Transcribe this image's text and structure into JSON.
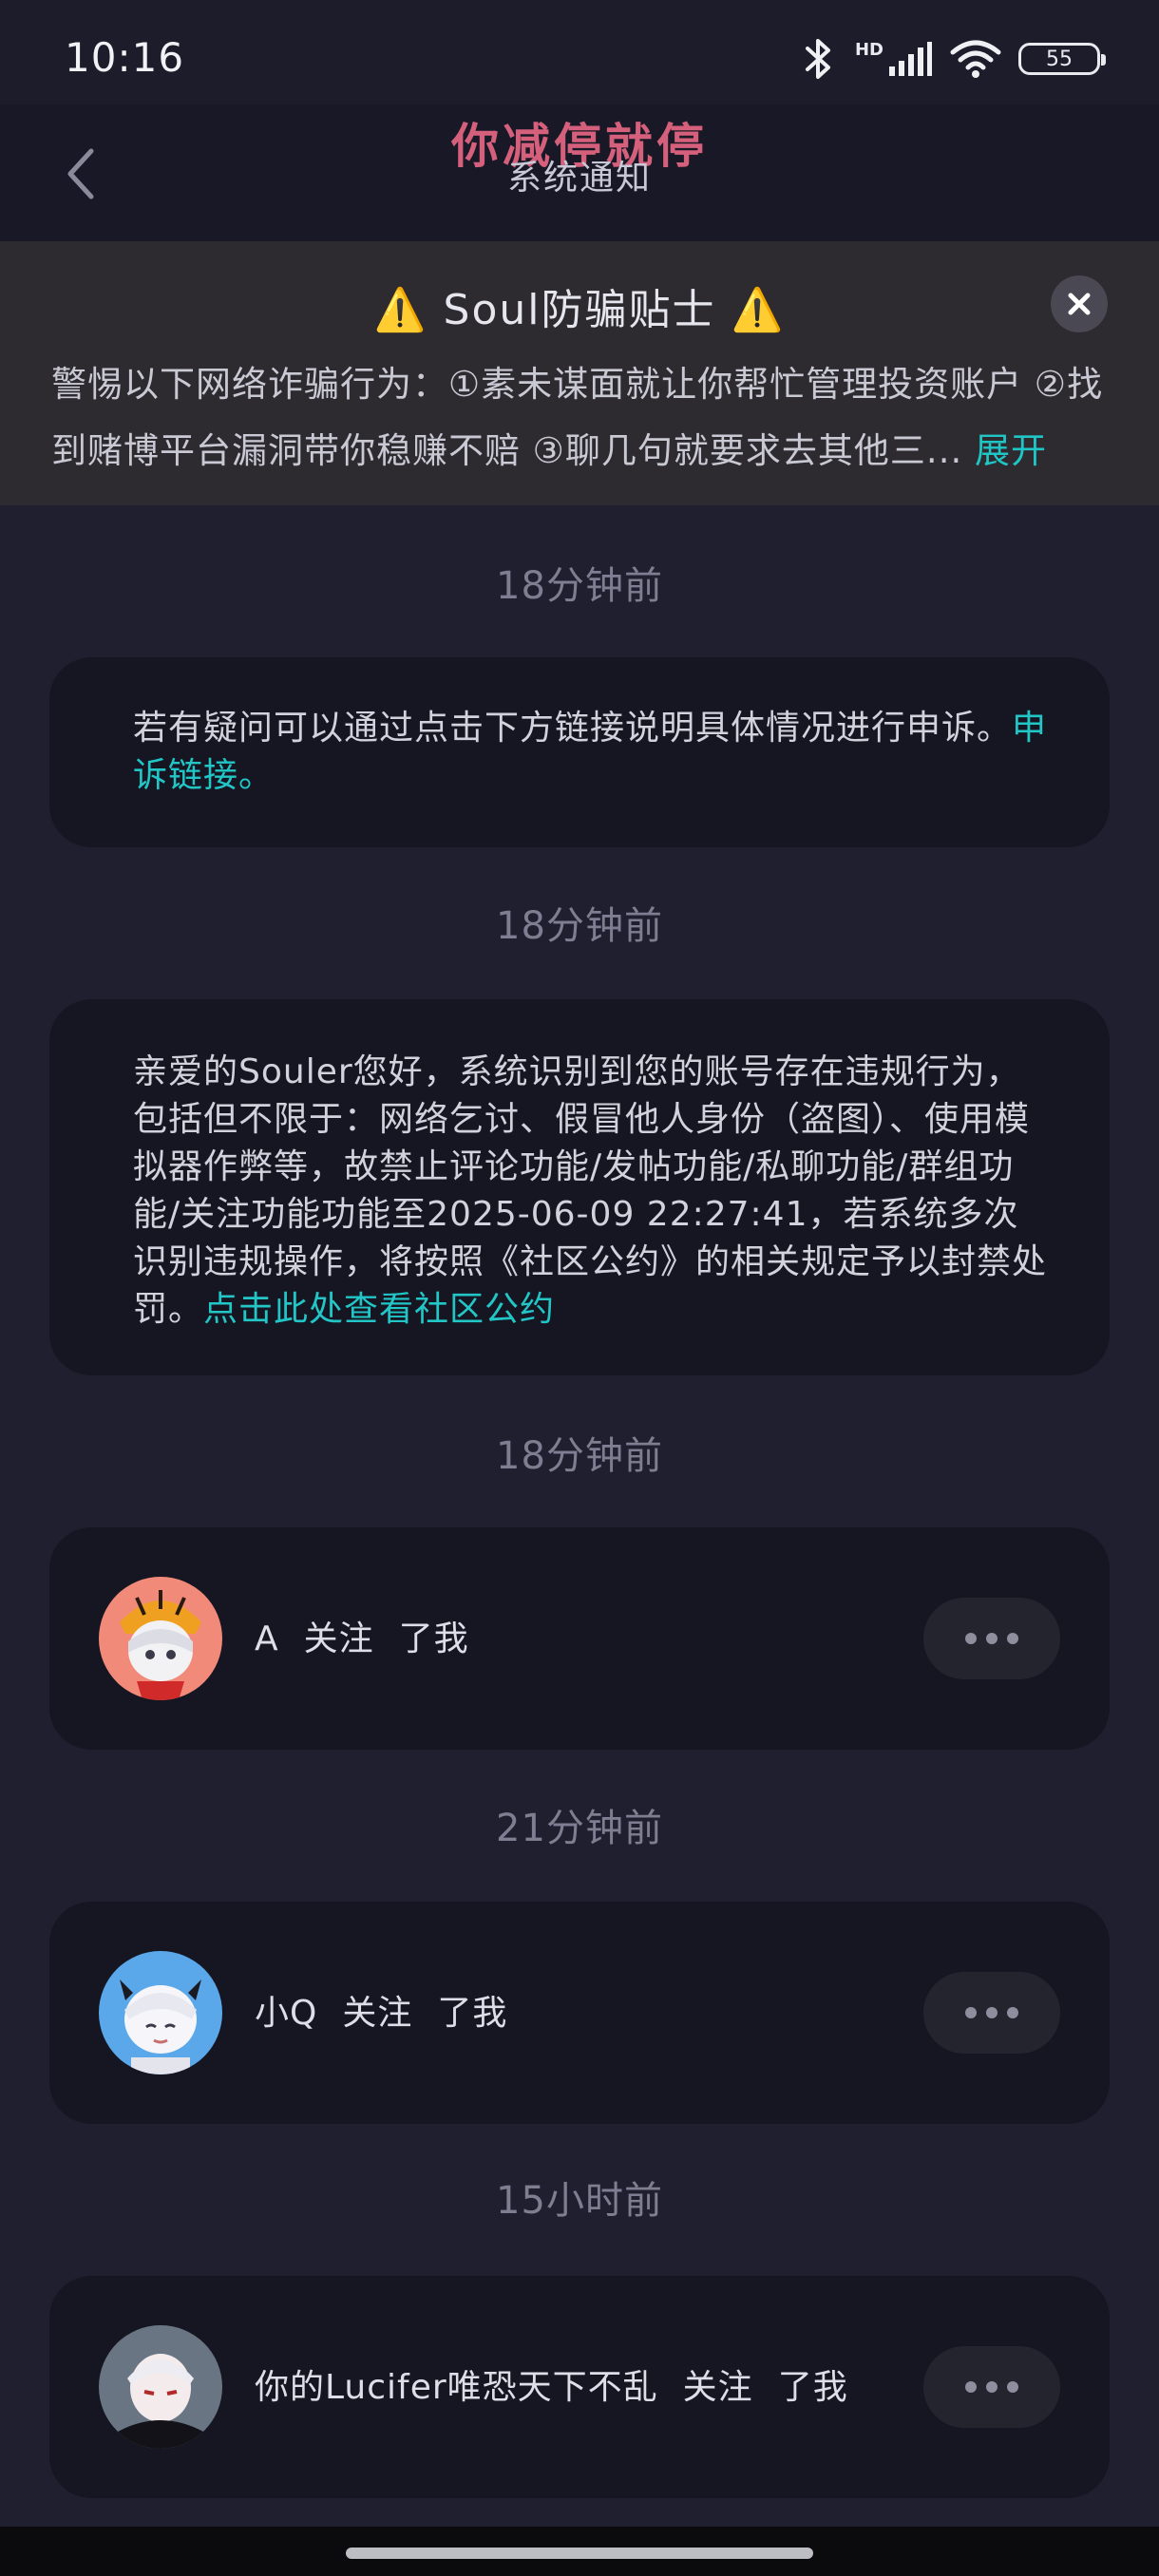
{
  "status_bar": {
    "time": "10:16",
    "hd": "HD",
    "battery": "55"
  },
  "header": {
    "brand": "你减停就停",
    "title": "系统通知"
  },
  "notice": {
    "title": "Soul防骗贴士",
    "warning_icon": "⚠️",
    "body": "警惕以下网络诈骗行为：①素未谋面就让你帮忙管理投资账户 ②找到赌博平台漏洞带你稳赚不赔 ③聊几句就要求去其他三...",
    "expand_label": "展开"
  },
  "messages": [
    {
      "time": "18分钟前",
      "type": "text",
      "text": "若有疑问可以通过点击下方链接说明具体情况进行申诉。",
      "link_label": "申诉链接。"
    },
    {
      "time": "18分钟前",
      "type": "text",
      "text": "亲爱的Souler您好，系统识别到您的账号存在违规行为，包括但不限于：网络乞讨、假冒他人身份（盗图）、使用模拟器作弊等，故禁止评论功能/发帖功能/私聊功能/群组功能/关注功能功能至2025-06-09 22:27:41，若系统多次识别违规操作，将按照《社区公约》的相关规定予以封禁处罚。",
      "link_label": "点击此处查看社区公约"
    },
    {
      "time": "18分钟前",
      "type": "follow",
      "user": "A",
      "action": "关注",
      "object": "了我"
    },
    {
      "time": "21分钟前",
      "type": "follow",
      "user": "小Q",
      "action": "关注",
      "object": "了我"
    },
    {
      "time": "15小时前",
      "type": "follow",
      "user": "你的Lucifer唯恐天下不乱",
      "action": "关注",
      "object": "了我"
    }
  ],
  "colors": {
    "background": "#1f1f2f",
    "card": "#161622",
    "link": "#22c6c6",
    "brand": "#d4607c",
    "warning": "#f4c21c"
  }
}
